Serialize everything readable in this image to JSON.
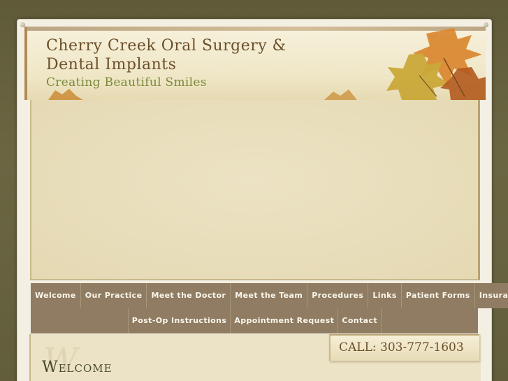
{
  "header": {
    "title_line1": "Cherry Creek Oral Surgery &",
    "title_line2": "Dental Implants",
    "tagline": "Creating Beautiful Smiles"
  },
  "nav": {
    "row1": [
      "Welcome",
      "Our Practice",
      "Meet the Doctor",
      "Meet the Team",
      "Procedures",
      "Links",
      "Patient Forms",
      "Insurance"
    ],
    "row2": [
      "Post-Op Instructions",
      "Appointment Request",
      "Contact"
    ]
  },
  "call": {
    "label": "CALL:",
    "phone": "303-777-1603"
  },
  "welcome": {
    "heading": "Welcome",
    "script_letter": "W"
  },
  "colors": {
    "page_bg": "#625d3b",
    "nav_bg": "#8f7c62",
    "nav_text": "#fbf7ec",
    "title_text": "#6b4f2a",
    "tagline_text": "#7a8a3a",
    "parchment": "#e9dfbd"
  },
  "icons": [
    "maple-leaf-cluster"
  ]
}
